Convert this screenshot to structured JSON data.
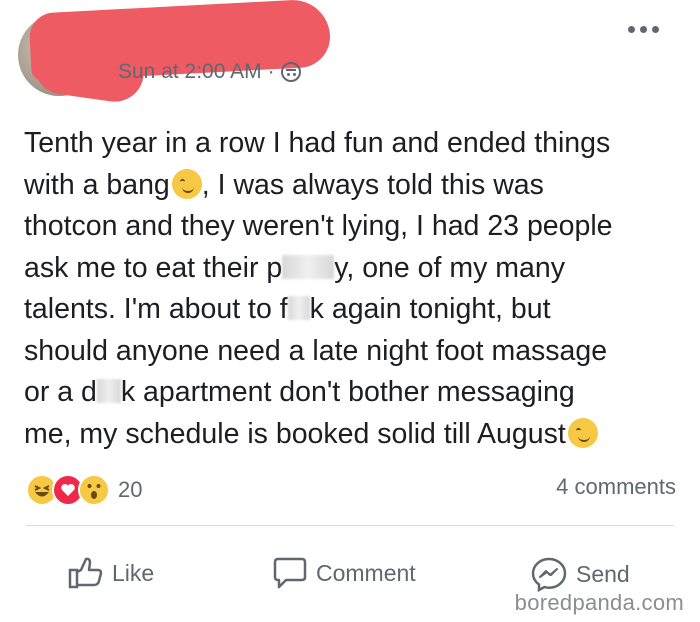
{
  "post": {
    "timestamp": "Sun at 2:00 AM",
    "separator": "·",
    "privacy_icon": "globe-icon",
    "more_icon": "more-options-icon",
    "text_lines": [
      [
        "Tenth year in a row I had fun and ended things"
      ],
      [
        "with a bang",
        ", I was always told this was"
      ],
      [
        "thotcon and they weren't lying, I had 23 people"
      ],
      [
        "ask me to eat their p",
        "y, one of my many"
      ],
      [
        "talents.  I'm about to f",
        "k again tonight, but"
      ],
      [
        "should anyone need a late night foot massage"
      ],
      [
        "or a d",
        "k apartment don't bother messaging"
      ],
      [
        "me, my schedule is booked solid till August"
      ]
    ]
  },
  "reactions": {
    "icons": [
      "haha-reaction-icon",
      "love-reaction-icon",
      "wow-reaction-icon"
    ],
    "count": "20",
    "comments": "4 comments"
  },
  "actions": {
    "like": "Like",
    "comment": "Comment",
    "send": "Send"
  },
  "watermark": "boredpanda.com",
  "colors": {
    "redaction": "#ee5b63",
    "meta_text": "#616770",
    "love": "#f0284a",
    "emoji": "#f7c844"
  }
}
